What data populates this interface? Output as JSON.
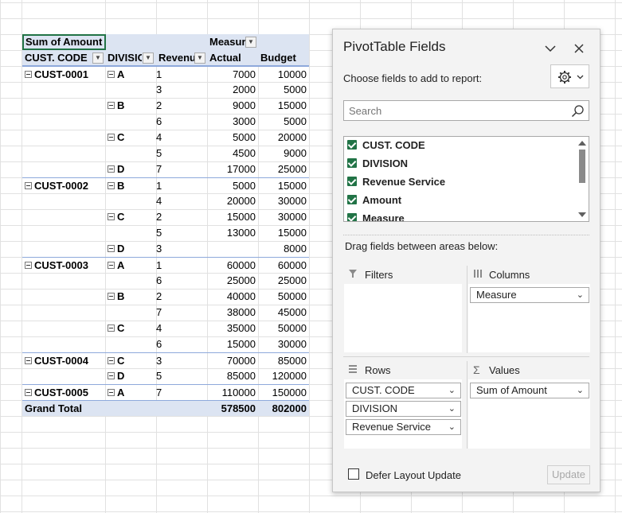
{
  "pivot": {
    "header": {
      "sum_label": "Sum of Amount",
      "measure_label": "Measure",
      "cust_code": "CUST. CODE",
      "division": "DIVISION",
      "revenue": "Revenue Service",
      "actual": "Actual",
      "budget": "Budget"
    },
    "rows": [
      {
        "cust": "CUST-0001",
        "div": "A",
        "rev": "1",
        "actual": "7000",
        "budget": "10000"
      },
      {
        "cust": "",
        "div": "",
        "rev": "3",
        "actual": "2000",
        "budget": "5000"
      },
      {
        "cust": "",
        "div": "B",
        "rev": "2",
        "actual": "9000",
        "budget": "15000"
      },
      {
        "cust": "",
        "div": "",
        "rev": "6",
        "actual": "3000",
        "budget": "5000"
      },
      {
        "cust": "",
        "div": "C",
        "rev": "4",
        "actual": "5000",
        "budget": "20000"
      },
      {
        "cust": "",
        "div": "",
        "rev": "5",
        "actual": "4500",
        "budget": "9000"
      },
      {
        "cust": "",
        "div": "D",
        "rev": "7",
        "actual": "17000",
        "budget": "25000"
      },
      {
        "cust": "CUST-0002",
        "div": "B",
        "rev": "1",
        "actual": "5000",
        "budget": "15000"
      },
      {
        "cust": "",
        "div": "",
        "rev": "4",
        "actual": "20000",
        "budget": "30000"
      },
      {
        "cust": "",
        "div": "C",
        "rev": "2",
        "actual": "15000",
        "budget": "30000"
      },
      {
        "cust": "",
        "div": "",
        "rev": "5",
        "actual": "13000",
        "budget": "15000"
      },
      {
        "cust": "",
        "div": "D",
        "rev": "3",
        "actual": "",
        "budget": "8000"
      },
      {
        "cust": "CUST-0003",
        "div": "A",
        "rev": "1",
        "actual": "60000",
        "budget": "60000"
      },
      {
        "cust": "",
        "div": "",
        "rev": "6",
        "actual": "25000",
        "budget": "25000"
      },
      {
        "cust": "",
        "div": "B",
        "rev": "2",
        "actual": "40000",
        "budget": "50000"
      },
      {
        "cust": "",
        "div": "",
        "rev": "7",
        "actual": "38000",
        "budget": "45000"
      },
      {
        "cust": "",
        "div": "C",
        "rev": "4",
        "actual": "35000",
        "budget": "50000"
      },
      {
        "cust": "",
        "div": "",
        "rev": "6",
        "actual": "15000",
        "budget": "30000"
      },
      {
        "cust": "CUST-0004",
        "div": "C",
        "rev": "3",
        "actual": "70000",
        "budget": "85000"
      },
      {
        "cust": "",
        "div": "D",
        "rev": "5",
        "actual": "85000",
        "budget": "120000"
      },
      {
        "cust": "CUST-0005",
        "div": "A",
        "rev": "7",
        "actual": "110000",
        "budget": "150000"
      }
    ],
    "grand_total": {
      "label": "Grand Total",
      "actual": "578500",
      "budget": "802000"
    }
  },
  "pane": {
    "title": "PivotTable Fields",
    "choose_label": "Choose fields to add to report:",
    "search_placeholder": "Search",
    "fields": [
      "CUST. CODE",
      "DIVISION",
      "Revenue Service",
      "Amount",
      "Measure"
    ],
    "drag_label": "Drag fields between areas below:",
    "areas": {
      "filters": "Filters",
      "columns": "Columns",
      "rows": "Rows",
      "values": "Values"
    },
    "columns_items": [
      "Measure"
    ],
    "rows_items": [
      "CUST. CODE",
      "DIVISION",
      "Revenue Service"
    ],
    "values_items": [
      "Sum of Amount"
    ],
    "defer_label": "Defer Layout Update",
    "update_label": "Update"
  }
}
